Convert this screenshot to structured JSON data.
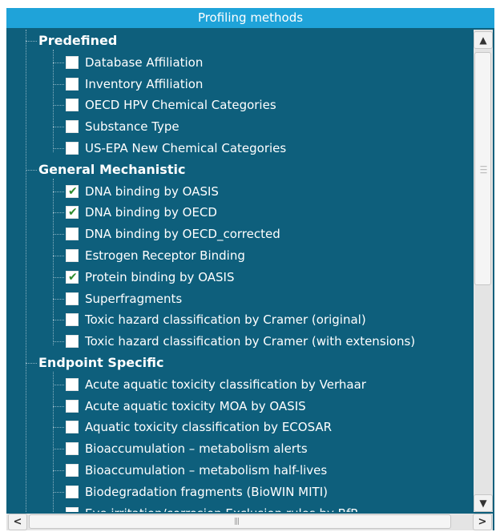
{
  "panel": {
    "title": "Profiling methods",
    "colors": {
      "panel_bg": "#0e5f7c",
      "title_bg": "#1fa3d9",
      "checkmark": "#2e8b2e"
    }
  },
  "groups": [
    {
      "label": "Predefined",
      "items": [
        {
          "label": "Database Affiliation",
          "checked": false
        },
        {
          "label": "Inventory Affiliation",
          "checked": false
        },
        {
          "label": "OECD HPV Chemical Categories",
          "checked": false
        },
        {
          "label": "Substance Type",
          "checked": false
        },
        {
          "label": "US-EPA New Chemical Categories",
          "checked": false
        }
      ]
    },
    {
      "label": "General Mechanistic",
      "items": [
        {
          "label": "DNA binding by OASIS",
          "checked": true
        },
        {
          "label": "DNA binding by OECD",
          "checked": true
        },
        {
          "label": "DNA binding by OECD_corrected",
          "checked": false
        },
        {
          "label": "Estrogen Receptor Binding",
          "checked": false
        },
        {
          "label": "Protein binding by OASIS",
          "checked": true
        },
        {
          "label": "Superfragments",
          "checked": false
        },
        {
          "label": "Toxic hazard classification by Cramer (original)",
          "checked": false
        },
        {
          "label": "Toxic hazard classification by Cramer (with extensions)",
          "checked": false
        }
      ]
    },
    {
      "label": "Endpoint Specific",
      "items": [
        {
          "label": "Acute aquatic toxicity classification by Verhaar",
          "checked": false
        },
        {
          "label": "Acute aquatic toxicity MOA by OASIS",
          "checked": false
        },
        {
          "label": "Aquatic toxicity classification by ECOSAR",
          "checked": false
        },
        {
          "label": "Bioaccumulation – metabolism alerts",
          "checked": false
        },
        {
          "label": "Bioaccumulation – metabolism half-lives",
          "checked": false
        },
        {
          "label": "Biodegradation fragments (BioWIN MITI)",
          "checked": false
        },
        {
          "label": "Eye irritation/corrosion Exclusion rules by BfR",
          "checked": false
        }
      ]
    }
  ],
  "scrollbars": {
    "up_icon": "up-arrow-icon",
    "down_icon": "down-arrow-icon",
    "left_icon": "left-arrow-icon",
    "right_icon": "right-arrow-icon",
    "vertical_position": 0.0
  }
}
